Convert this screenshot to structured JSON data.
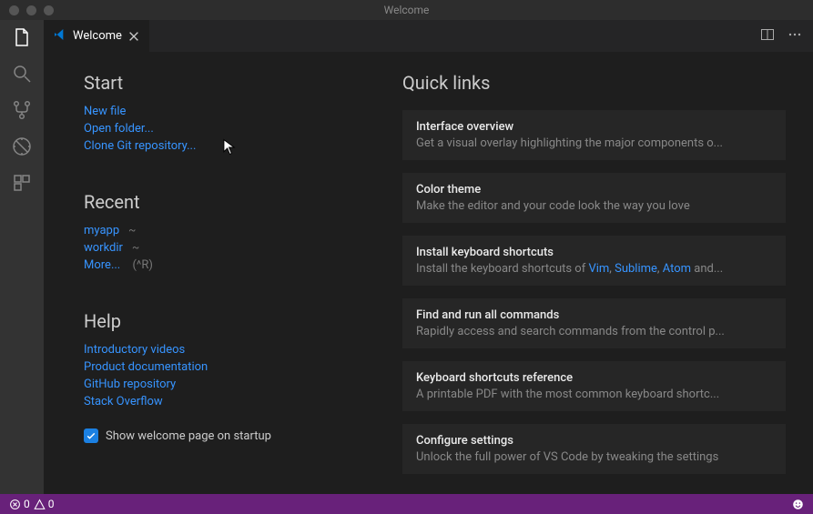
{
  "window": {
    "title": "Welcome"
  },
  "tab": {
    "label": "Welcome"
  },
  "start": {
    "heading": "Start",
    "links": {
      "new_file": "New file",
      "open_folder": "Open folder...",
      "clone_git": "Clone Git repository..."
    }
  },
  "recent": {
    "heading": "Recent",
    "items": [
      {
        "name": "myapp",
        "path": "~"
      },
      {
        "name": "workdir",
        "path": "~"
      }
    ],
    "more_label": "More...",
    "more_shortcut": "(^R)"
  },
  "help": {
    "heading": "Help",
    "links": {
      "videos": "Introductory videos",
      "docs": "Product documentation",
      "github": "GitHub repository",
      "stackoverflow": "Stack Overflow"
    }
  },
  "startup": {
    "checkbox_label": "Show welcome page on startup",
    "checked": true
  },
  "quicklinks": {
    "heading": "Quick links",
    "cards": {
      "interface": {
        "title": "Interface overview",
        "desc": "Get a visual overlay highlighting the major components o..."
      },
      "theme": {
        "title": "Color theme",
        "desc": "Make the editor and your code look the way you love"
      },
      "keymaps": {
        "title": "Install keyboard shortcuts",
        "desc_prefix": "Install the keyboard shortcuts of ",
        "link1": "Vim",
        "sep1": ", ",
        "link2": "Sublime",
        "sep2": ", ",
        "link3": "Atom",
        "suffix": " and..."
      },
      "commands": {
        "title": "Find and run all commands",
        "desc": "Rapidly access and search commands from the control p..."
      },
      "shortcuts": {
        "title": "Keyboard shortcuts reference",
        "desc": "A printable PDF with the most common keyboard shortc..."
      },
      "settings": {
        "title": "Configure settings",
        "desc": "Unlock the full power of VS Code by tweaking the settings"
      }
    }
  },
  "statusbar": {
    "errors": "0",
    "warnings": "0"
  }
}
